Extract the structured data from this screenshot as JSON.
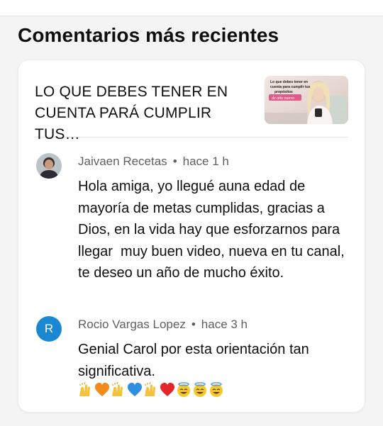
{
  "section": {
    "title": "Comentarios más recientes"
  },
  "video": {
    "title": "LO QUE DEBES TENER EN CUENTA PARÁ CUMPLIR TUS…",
    "thumbnail_caption": "Lo que debes tener en cuenta para cumplir tus propósitos de año nuevo"
  },
  "comments": [
    {
      "author": "Jaivaen Recetas",
      "separator": "•",
      "time": "hace 1 h",
      "text": "Hola amiga, yo llegué auna edad de mayoría de metas cumplidas, gracias a Dios, en la vida hay que esforzarnos para llegar  muy buen video, nueva en tu canal, te deseo un año de mucho éxito."
    },
    {
      "author": "Rocio Vargas Lopez",
      "avatar_letter": "R",
      "separator": "•",
      "time": "hace 3 h",
      "text": "Genial Carol por esta orientación tan significativa.",
      "emojis": [
        "raising-hands",
        "orange-heart",
        "raising-hands",
        "blue-heart",
        "raising-hands",
        "red-heart",
        "halo-face",
        "halo-face",
        "halo-face"
      ]
    }
  ],
  "colors": {
    "avatar_blue": "#1a88d1",
    "meta_gray": "#606060"
  }
}
